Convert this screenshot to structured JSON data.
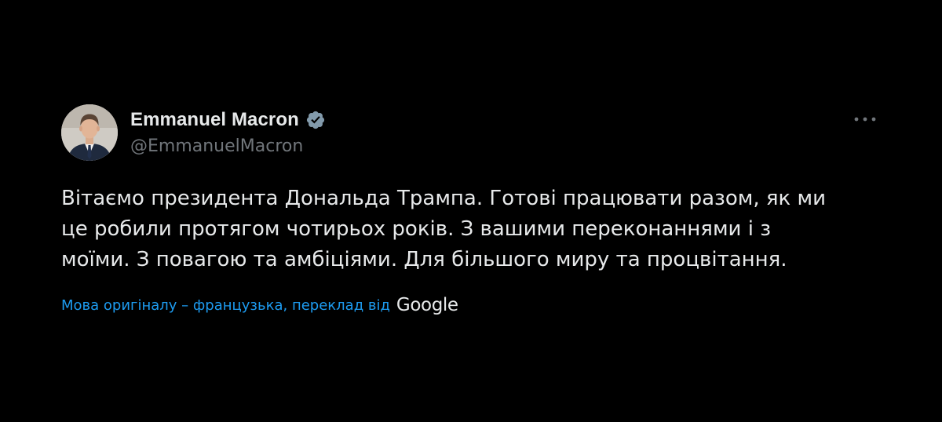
{
  "author": {
    "display_name": "Emmanuel Macron",
    "handle": "@EmmanuelMacron",
    "verified": true,
    "verified_color": "#829aab"
  },
  "tweet": {
    "lines": [
      "Вітаємо президента Дональда Трампа. Готові працювати разом, як ми",
      "це робили протягом чотирьох років. З вашими переконаннями і з",
      "моїми. З повагою та амбіціями. Для більшого миру та процвітання."
    ]
  },
  "translation": {
    "label": "Мова оригіналу – французька, переклад від",
    "provider": "Google"
  },
  "icons": {
    "avatar": "profile-photo",
    "verified": "verified-badge-icon",
    "more": "more-options-icon"
  },
  "colors": {
    "background": "#000000",
    "text_primary": "#e7e9ea",
    "text_secondary": "#71767b",
    "link": "#1d9bf0"
  }
}
